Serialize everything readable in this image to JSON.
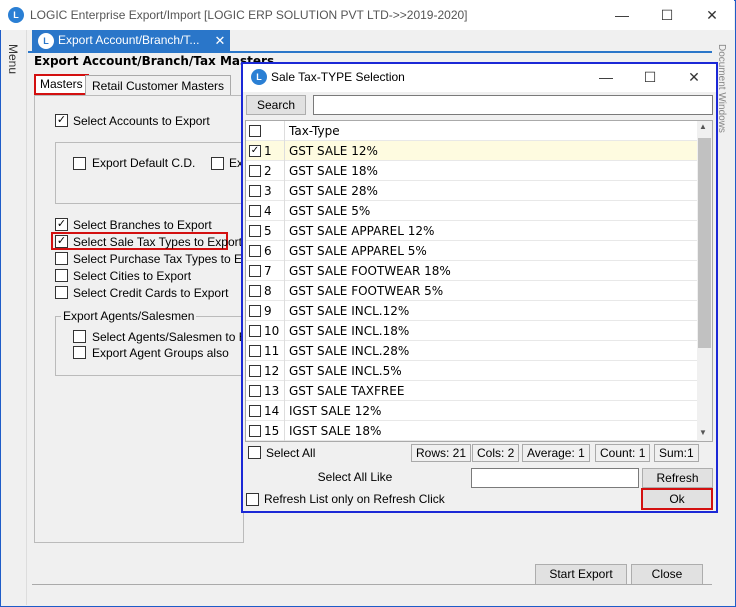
{
  "app": {
    "title": "LOGIC Enterprise Export/Import  [LOGIC ERP SOLUTION PVT LTD->>2019-2020]",
    "logo_letter": "L",
    "minimize": "—",
    "maximize": "☐",
    "close": "✕"
  },
  "menu_label": "Menu",
  "right_panel_label": "Document Windows",
  "doc_tab": {
    "label": "Export Account/Branch/T...",
    "close": "✕",
    "dropdown": "▼"
  },
  "form_title": "Export Account/Branch/Tax Masters",
  "subtabs": {
    "masters": "Masters",
    "retail": "Retail Customer Masters"
  },
  "options": {
    "select_accounts": {
      "label": "Select Accounts to Export",
      "checked": true
    },
    "export_default_cd": {
      "label": "Export Default C.D.",
      "checked": false
    },
    "ex_partial": {
      "label": "Ex",
      "checked": false
    },
    "select_branches": {
      "label": "Select Branches to Export",
      "checked": true
    },
    "select_sale_tax": {
      "label": "Select Sale Tax Types to Export",
      "checked": true
    },
    "select_purchase_tax": {
      "label": "Select Purchase Tax Types to Expo",
      "checked": false
    },
    "select_cities": {
      "label": "Select Cities to Export",
      "checked": false
    },
    "select_credit_cards": {
      "label": "Select Credit Cards to Export",
      "checked": false
    },
    "agents_group_title": "Export Agents/Salesmen",
    "select_agents": {
      "label": "Select Agents/Salesmen to Exp",
      "checked": false
    },
    "export_agent_groups": {
      "label": "Export Agent Groups also",
      "checked": false
    }
  },
  "buttons": {
    "start_export": "Start Export",
    "close": "Close"
  },
  "dialog": {
    "title": "Sale Tax-TYPE Selection",
    "minimize": "—",
    "maximize": "☐",
    "close": "✕",
    "search_label": "Search",
    "search_value": "",
    "header": "Tax-Type",
    "rows": [
      {
        "num": "1",
        "name": "GST SALE 12%",
        "checked": true
      },
      {
        "num": "2",
        "name": "GST SALE 18%",
        "checked": false
      },
      {
        "num": "3",
        "name": "GST SALE 28%",
        "checked": false
      },
      {
        "num": "4",
        "name": "GST SALE 5%",
        "checked": false
      },
      {
        "num": "5",
        "name": "GST SALE APPAREL 12%",
        "checked": false
      },
      {
        "num": "6",
        "name": "GST SALE APPAREL 5%",
        "checked": false
      },
      {
        "num": "7",
        "name": "GST SALE FOOTWEAR 18%",
        "checked": false
      },
      {
        "num": "8",
        "name": "GST SALE FOOTWEAR 5%",
        "checked": false
      },
      {
        "num": "9",
        "name": "GST SALE INCL.12%",
        "checked": false
      },
      {
        "num": "10",
        "name": "GST SALE INCL.18%",
        "checked": false
      },
      {
        "num": "11",
        "name": "GST SALE INCL.28%",
        "checked": false
      },
      {
        "num": "12",
        "name": "GST SALE INCL.5%",
        "checked": false
      },
      {
        "num": "13",
        "name": "GST SALE TAXFREE",
        "checked": false
      },
      {
        "num": "14",
        "name": "IGST SALE 12%",
        "checked": false
      },
      {
        "num": "15",
        "name": "IGST SALE 18%",
        "checked": false
      }
    ],
    "select_all": "Select All",
    "status": {
      "rows": "Rows: 21",
      "cols": "Cols: 2",
      "average": "Average: 1",
      "count": "Count: 1",
      "sum": "Sum:1"
    },
    "select_all_like": "Select All Like",
    "select_all_like_value": "",
    "refresh": "Refresh",
    "refresh_only_label": "Refresh List only on Refresh Click",
    "ok": "Ok"
  }
}
